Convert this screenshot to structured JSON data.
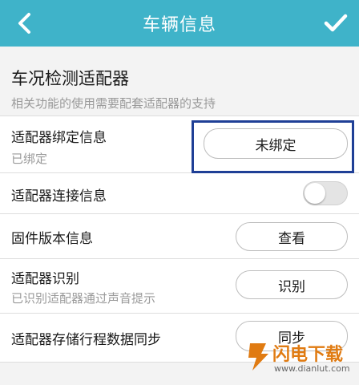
{
  "header": {
    "title": "车辆信息",
    "back_icon": "chevron-left-icon",
    "confirm_icon": "check-icon",
    "color": "#3fb3c9"
  },
  "section": {
    "title": "车况检测适配器",
    "subtitle": "相关功能的使用需要配套适配器的支持"
  },
  "rows": [
    {
      "label": "适配器绑定信息",
      "sub": "已绑定",
      "button": "未绑定"
    },
    {
      "label": "适配器连接信息",
      "toggle_on": false
    },
    {
      "label": "固件版本信息",
      "button": "查看"
    },
    {
      "label": "适配器识别",
      "sub": "已识别适配器通过声音提示",
      "button": "识别"
    },
    {
      "label": "适配器存储行程数据同步",
      "button": "同步"
    }
  ],
  "watermark": {
    "text": "闪电下载",
    "url": "www.dianlut.com",
    "color": "#e07b12"
  },
  "highlight_color": "#1f3f96"
}
